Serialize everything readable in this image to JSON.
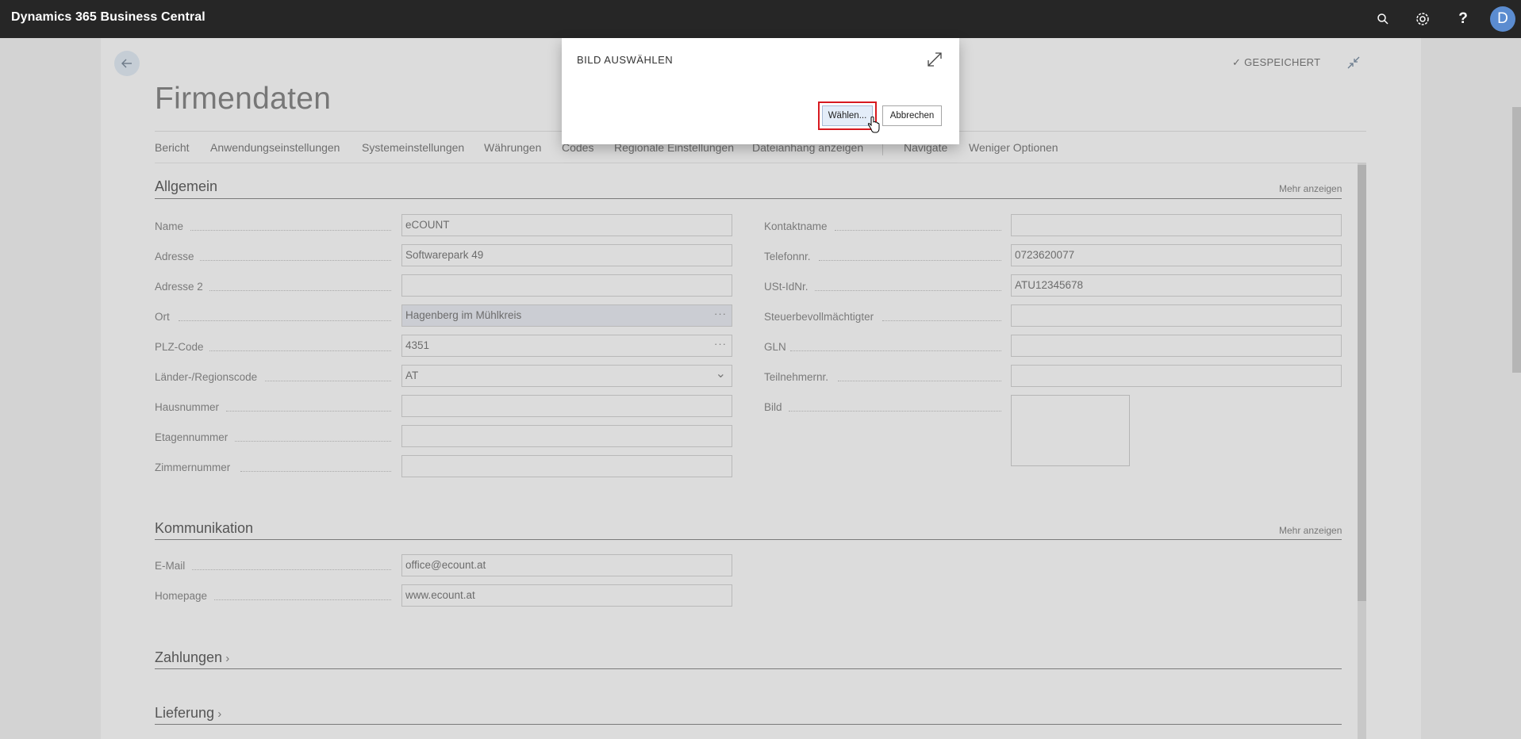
{
  "app": {
    "title": "Dynamics 365 Business Central",
    "avatar_initial": "D"
  },
  "topbar_icons": [
    "search-icon",
    "settings-gear-icon",
    "help-icon"
  ],
  "page": {
    "title": "Firmendaten",
    "saved_status": "GESPEICHERT"
  },
  "actions": [
    "Bericht",
    "Anwendungseinstellungen",
    "Systemeinstellungen",
    "Währungen",
    "Codes",
    "Regionale Einstellungen",
    "Dateianhang anzeigen",
    "Navigate",
    "Weniger Optionen"
  ],
  "sections": {
    "general": {
      "title": "Allgemein",
      "more": "Mehr anzeigen"
    },
    "communication": {
      "title": "Kommunikation",
      "more": "Mehr anzeigen"
    },
    "payments": {
      "title": "Zahlungen"
    },
    "delivery": {
      "title": "Lieferung"
    }
  },
  "general_left": [
    {
      "label": "Name",
      "value": "eCOUNT"
    },
    {
      "label": "Adresse",
      "value": "Softwarepark 49"
    },
    {
      "label": "Adresse 2",
      "value": ""
    },
    {
      "label": "Ort",
      "value": "Hagenberg im Mühlkreis",
      "suffix": "···"
    },
    {
      "label": "PLZ-Code",
      "value": "4351",
      "suffix": "···"
    },
    {
      "label": "Länder-/Regionscode",
      "value": "AT",
      "suffix": "⌄"
    },
    {
      "label": "Hausnummer",
      "value": ""
    },
    {
      "label": "Etagennummer",
      "value": ""
    },
    {
      "label": "Zimmernummer",
      "value": ""
    }
  ],
  "general_right": [
    {
      "label": "Kontaktname",
      "value": ""
    },
    {
      "label": "Telefonnr.",
      "value": "0723620077"
    },
    {
      "label": "USt-IdNr.",
      "value": "ATU12345678"
    },
    {
      "label": "Steuerbevollmächtigter",
      "value": ""
    },
    {
      "label": "GLN",
      "value": ""
    },
    {
      "label": "Teilnehmernr.",
      "value": ""
    },
    {
      "label": "Bild",
      "value": ""
    }
  ],
  "communication": [
    {
      "label": "E-Mail",
      "value": "office@ecount.at"
    },
    {
      "label": "Homepage",
      "value": "www.ecount.at"
    }
  ],
  "dialog": {
    "title": "BILD AUSWÄHLEN",
    "choose_label": "Wählen...",
    "cancel_label": "Abbrechen"
  }
}
